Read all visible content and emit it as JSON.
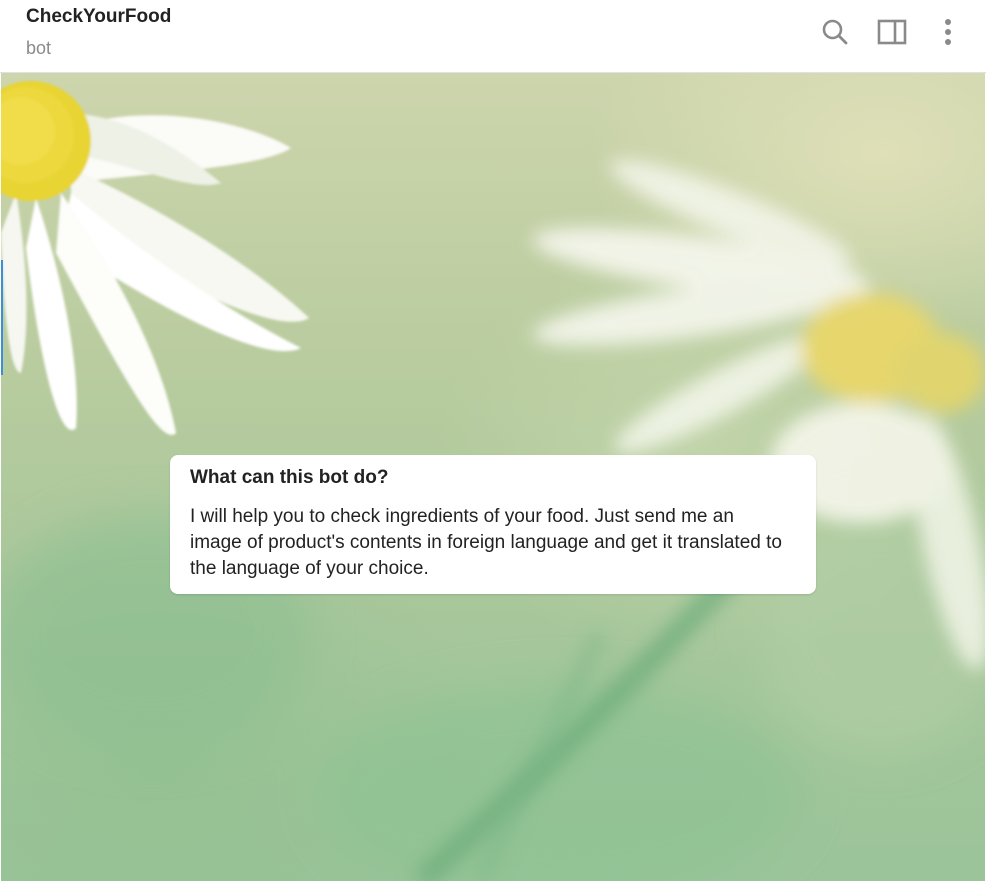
{
  "header": {
    "title": "CheckYourFood",
    "subtitle": "bot",
    "icons": {
      "search": "search-icon",
      "sidebar": "sidebar-panel-icon",
      "more": "more-vertical-icon"
    }
  },
  "bot_info": {
    "title": "What can this bot do?",
    "description": "I will help you to check ingredients of your food. Just send me an image of product's contents in foreign language and get it translated to the language of your choice."
  },
  "colors": {
    "accent": "#3a8fd6",
    "icon": "#8a8a8a",
    "flower_petal": "#ffffff",
    "flower_center": "#e5d64a"
  }
}
